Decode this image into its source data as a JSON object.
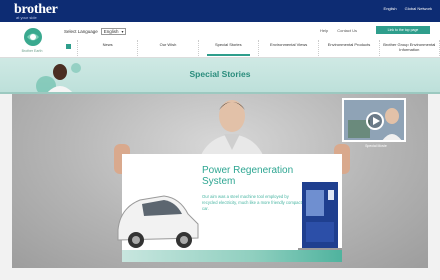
{
  "header": {
    "logo": "brother",
    "logo_tagline": "at your side",
    "top_links": [
      "English",
      "Global Network"
    ]
  },
  "subheader": {
    "env_logo_text": "Brother Earth",
    "language_label": "Select Language",
    "language_value": "English",
    "util_links": [
      "Help",
      "Contact Us"
    ],
    "cta_label": "Link to the top page"
  },
  "nav": {
    "items": [
      {
        "label": "News",
        "active": false
      },
      {
        "label": "Our Wish",
        "active": false
      },
      {
        "label": "Special Stories",
        "active": true
      },
      {
        "label": "Environmental Views",
        "active": false
      },
      {
        "label": "Environmental Products",
        "active": false
      },
      {
        "label": "Brother Group Environmental Information",
        "active": false
      }
    ]
  },
  "banner": {
    "title": "Special Stories"
  },
  "hero": {
    "card_title": "Power Regeneration System",
    "card_text": "Our aim was a steel machine tool employed by recycled electricity, much like a more friendly compact car.",
    "video_caption": "Special Movie"
  },
  "colors": {
    "brand": "#0d2c73",
    "accent": "#2f9e8c"
  }
}
